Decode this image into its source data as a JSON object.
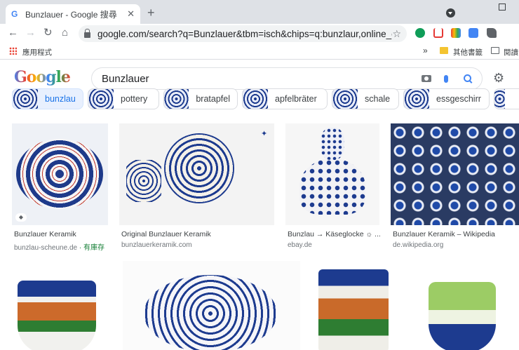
{
  "browser": {
    "tab_title": "Bunzlauer - Google 搜尋",
    "tab_favicon": "G",
    "close_tab": "✕",
    "new_tab": "+",
    "url": "google.com/search?q=Bunzlauer&tbm=isch&chips=q:bunzlaur,online_ch...",
    "back": "←",
    "forward": "→",
    "reload": "↻",
    "home": "⌂",
    "star": "☆"
  },
  "bookmarks": {
    "apps_label": "應用程式",
    "more": "»",
    "other_label": "其他書籤",
    "reading_label": "閱讀"
  },
  "search": {
    "logo": "Google",
    "query": "Bunzlauer",
    "settings": "⚙"
  },
  "chips": [
    {
      "label": "bunzlau",
      "selected": true
    },
    {
      "label": "pottery"
    },
    {
      "label": "bratapfel"
    },
    {
      "label": "apfelbräter"
    },
    {
      "label": "schale"
    },
    {
      "label": "essgeschirr"
    }
  ],
  "results": [
    {
      "title": "Bunzlauer Keramik",
      "source": "bunzlau-scheune.de",
      "stock": "· 有庫存"
    },
    {
      "title": "Original Bunzlauer Keramik",
      "source": "bunzlauerkeramik.com"
    },
    {
      "title": "Bunzlau → Käseglocke ☼ ...",
      "source": "ebay.de"
    },
    {
      "title": "Bunzlauer Keramik – Wikipedia",
      "source": "de.wikipedia.org"
    }
  ],
  "colors": {
    "accent": "#1a73e8",
    "tabbar": "#dee1e6",
    "stock_green": "#188038",
    "pottery_blue": "#1d3b8f"
  }
}
